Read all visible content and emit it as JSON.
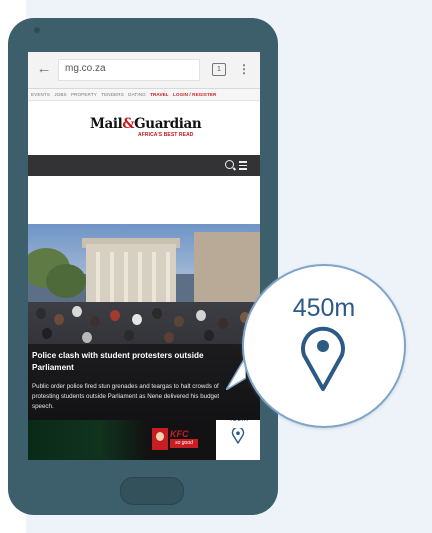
{
  "browser": {
    "url": "mg.co.za",
    "tab_count": "1"
  },
  "site": {
    "nav_items": [
      "EVENTS",
      "JOBS",
      "PROPERTY",
      "TENDERS",
      "DATING",
      "TRAVEL",
      "LOGIN / REGISTER"
    ],
    "logo_main": "Mail",
    "logo_amp": "&",
    "logo_main2": "Guardian",
    "logo_tagline": "AFRICA'S BEST READ"
  },
  "article": {
    "headline": "Police clash with student protesters outside Parliament",
    "summary": "Public order police fired stun grenades and teargas to halt crowds of protesting students outside Parliament as Nene delivered his budget speech."
  },
  "ad": {
    "brand": "KFC",
    "brand_tagline": "so good",
    "distance": "450m"
  },
  "bubble": {
    "distance": "450m"
  },
  "colors": {
    "phone_body": "#3d5f6b",
    "accent_blue": "#2d5a85",
    "brand_red": "#c6151b"
  }
}
